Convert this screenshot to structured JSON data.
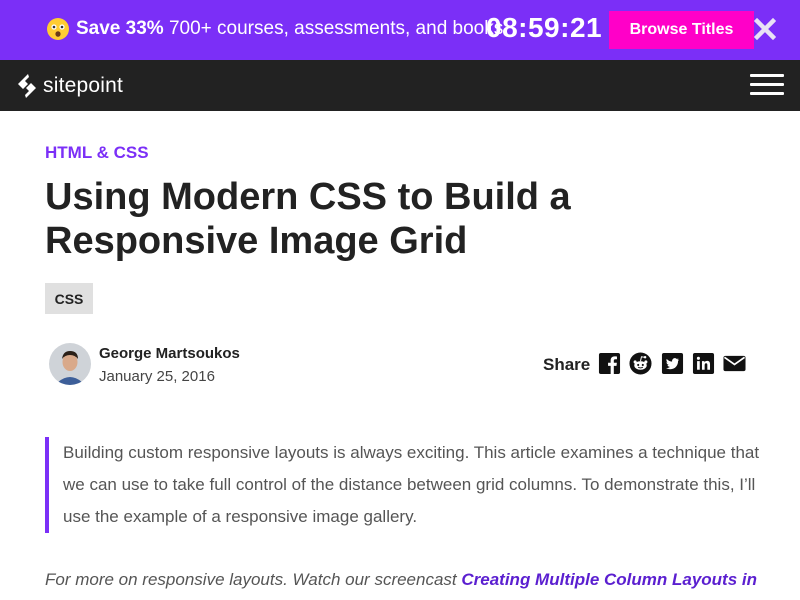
{
  "promo": {
    "emoji_icon": "astonished-face-icon",
    "save_text": "Save 33%",
    "offer_text": "700+ courses, assessments, and books",
    "timer": "08:59:21",
    "browse_label": "Browse Titles",
    "background": "#7b2ff7",
    "button_color": "#ff00c8"
  },
  "nav": {
    "logo_text": "sitepoint",
    "menu_icon": "hamburger-menu-icon",
    "background": "#222222"
  },
  "article": {
    "category": "HTML & CSS",
    "title": "Using Modern CSS to Build a Responsive Image Grid",
    "tag": "CSS",
    "author_name": "George Martsoukos",
    "date": "January 25, 2016",
    "share_label": "Share",
    "share_icons": [
      "facebook-icon",
      "reddit-icon",
      "twitter-icon",
      "linkedin-icon",
      "email-icon"
    ],
    "lead": "Building custom responsive layouts is always exciting. This article examines a technique that we can use to take full control of the distance between grid columns. To demonstrate this, I’ll use the example of a responsive image gallery.",
    "more_text": "For more on responsive layouts. Watch our screencast ",
    "more_link": "Creating Multiple Column Layouts in",
    "accent": "#7b2ff7"
  }
}
